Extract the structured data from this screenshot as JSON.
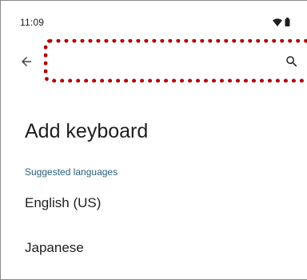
{
  "status_bar": {
    "time": "11:09",
    "icons": [
      "wifi-icon",
      "battery-icon"
    ]
  },
  "top_bar": {
    "back_icon": "arrow-back-icon",
    "search_icon": "search-icon",
    "highlight_color": "#b00000"
  },
  "page": {
    "title": "Add keyboard",
    "section_header": "Suggested languages",
    "languages": [
      {
        "label": "English (US)"
      },
      {
        "label": "Japanese"
      }
    ]
  },
  "colors": {
    "accent": "#27607f",
    "text": "#1f1f1f",
    "background": "#ffffff"
  }
}
